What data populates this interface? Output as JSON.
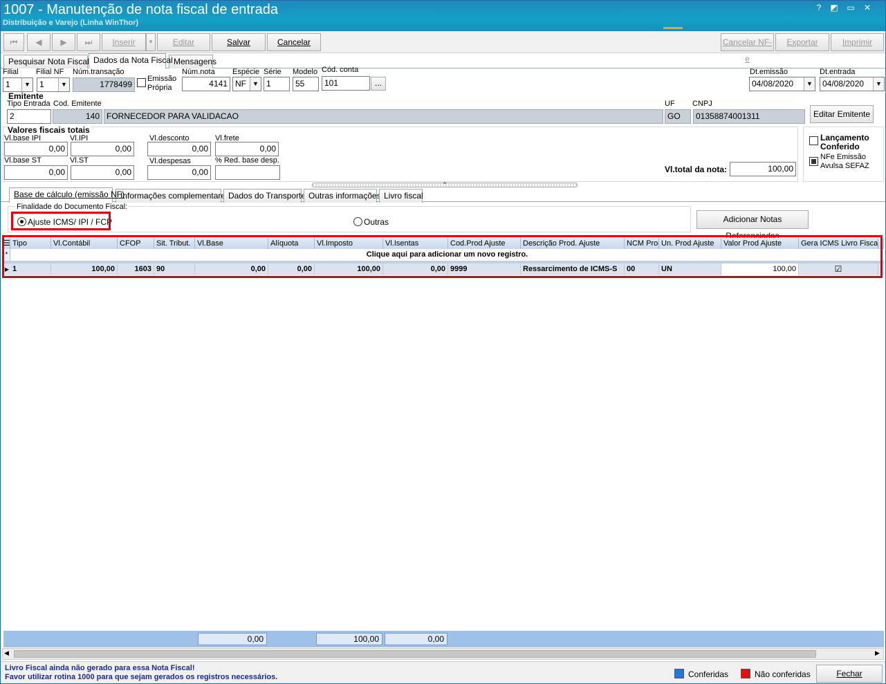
{
  "window": {
    "title": "1007 - Manutenção de nota fiscal de entrada",
    "subtitle": "Distribuição e Varejo (Linha WinThor)",
    "controls": [
      "?",
      "◩",
      "▭",
      "✕"
    ]
  },
  "toolbar": {
    "first": "⏮",
    "prev": "◀",
    "next": "▶",
    "last": "⏭",
    "inserir": "Inserir",
    "editar": "Editar",
    "salvar": "Salvar",
    "cancelar": "Cancelar",
    "cancelar_nfe": "Cancelar NF-e",
    "exportar": "Exportar",
    "imprimir": "Imprimir"
  },
  "main_tabs": [
    "Pesquisar Nota Fiscal",
    "Dados da Nota Fiscal",
    "Mensagens"
  ],
  "header": {
    "filial_label": "Filial",
    "filial": "1",
    "filial_nf_label": "Filial NF",
    "filial_nf": "1",
    "num_transacao_label": "Núm.transação",
    "num_transacao": "1778499",
    "emissao_propria_label1": "Emissão",
    "emissao_propria_label2": "Própria",
    "num_nota_label": "Núm.nota",
    "num_nota": "4141",
    "especie_label": "Espécie",
    "especie": "NF",
    "serie_label": "Série",
    "serie": "1",
    "modelo_label": "Modelo",
    "modelo": "55",
    "cod_conta_label": "Cód. conta",
    "cod_conta": "101",
    "cod_conta_btn": "...",
    "dt_emissao_label": "Dt.emissão",
    "dt_emissao": "04/08/2020",
    "dt_entrada_label": "Dt.entrada",
    "dt_entrada": "04/08/2020"
  },
  "emitente": {
    "section": "Emitente",
    "tipo_entrada_label": "Tipo Entrada",
    "tipo_entrada": "2",
    "cod_emitente_label": "Cod. Emitente",
    "cod_emitente": "140",
    "nome": "FORNECEDOR PARA VALIDACAO",
    "uf_label": "UF",
    "uf": "GO",
    "cnpj_label": "CNPJ",
    "cnpj": "01358874001311",
    "editar_btn": "Editar Emitente"
  },
  "valores": {
    "section": "Valores fiscais totais",
    "vl_base_ipi_label": "Vl.base IPI",
    "vl_base_ipi": "0,00",
    "vl_ipi_label": "Vl.IPI",
    "vl_ipi": "0,00",
    "vl_desconto_label": "Vl.desconto",
    "vl_desconto": "0,00",
    "vl_frete_label": "Vl.frete",
    "vl_frete": "0,00",
    "vl_base_st_label": "Vl.base ST",
    "vl_base_st": "0,00",
    "vl_st_label": "Vl.ST",
    "vl_st": "0,00",
    "vl_despesas_label": "Vl.despesas",
    "vl_despesas": "0,00",
    "red_base_label": "% Red. base desp.",
    "red_base": "",
    "vl_total_label": "Vl.total da nota:",
    "vl_total": "100,00"
  },
  "side": {
    "lancamento1": "Lançamento",
    "lancamento2": "Conferido",
    "nfe1": "NFe Emissão",
    "nfe2": "Avulsa SEFAZ"
  },
  "sub_tabs": [
    "Base de cálculo (emissão NF)",
    "Informações complementares",
    "Dados do Transporte",
    "Outras informações",
    "Livro fiscal"
  ],
  "finalidade": {
    "label": "Finalidade do Documento Fiscal:",
    "opt1": "Ajuste ICMS/ IPI / FCP",
    "opt2": "Outras",
    "add_btn": "Adicionar Notas Referenciadas"
  },
  "grid": {
    "columns": [
      "Tipo",
      "Vl.Contábil",
      "CFOP",
      "Sit. Tribut.",
      "Vl.Base",
      "Alíquota",
      "Vl.Imposto",
      "Vl.Isentas",
      "Cod.Prod Ajuste",
      "Descrição Prod. Ajuste",
      "NCM Proc",
      "Un. Prod Ajuste",
      "Valor Prod Ajuste",
      "Gera ICMS Livro Fiscal"
    ],
    "new_row": "Clique aqui para adicionar um novo registro.",
    "rows": [
      {
        "tipo": "1",
        "vl_contabil": "100,00",
        "cfop": "1603",
        "sit_tribut": "90",
        "vl_base": "0,00",
        "aliquota": "0,00",
        "vl_imposto": "100,00",
        "vl_isentas": "0,00",
        "cod_prod": "9999",
        "descricao": "Ressarcimento de ICMS-S",
        "ncm": "00",
        "un": "UN",
        "valor_prod": "100,00",
        "gera": "☑"
      }
    ],
    "totals": {
      "vl_base": "0,00",
      "vl_imposto": "100,00",
      "vl_isentas": "0,00"
    }
  },
  "status": {
    "line1": "Livro Fiscal ainda não gerado para essa Nota Fiscal!",
    "line2": "Favor utilizar rotina 1000 para que sejam gerados os registros necessários.",
    "conferidas": "Conferidas",
    "nao_conferidas": "Não conferidas",
    "fechar": "Fechar",
    "color_conferidas": "#1e78d8",
    "color_nao": "#e01010"
  }
}
